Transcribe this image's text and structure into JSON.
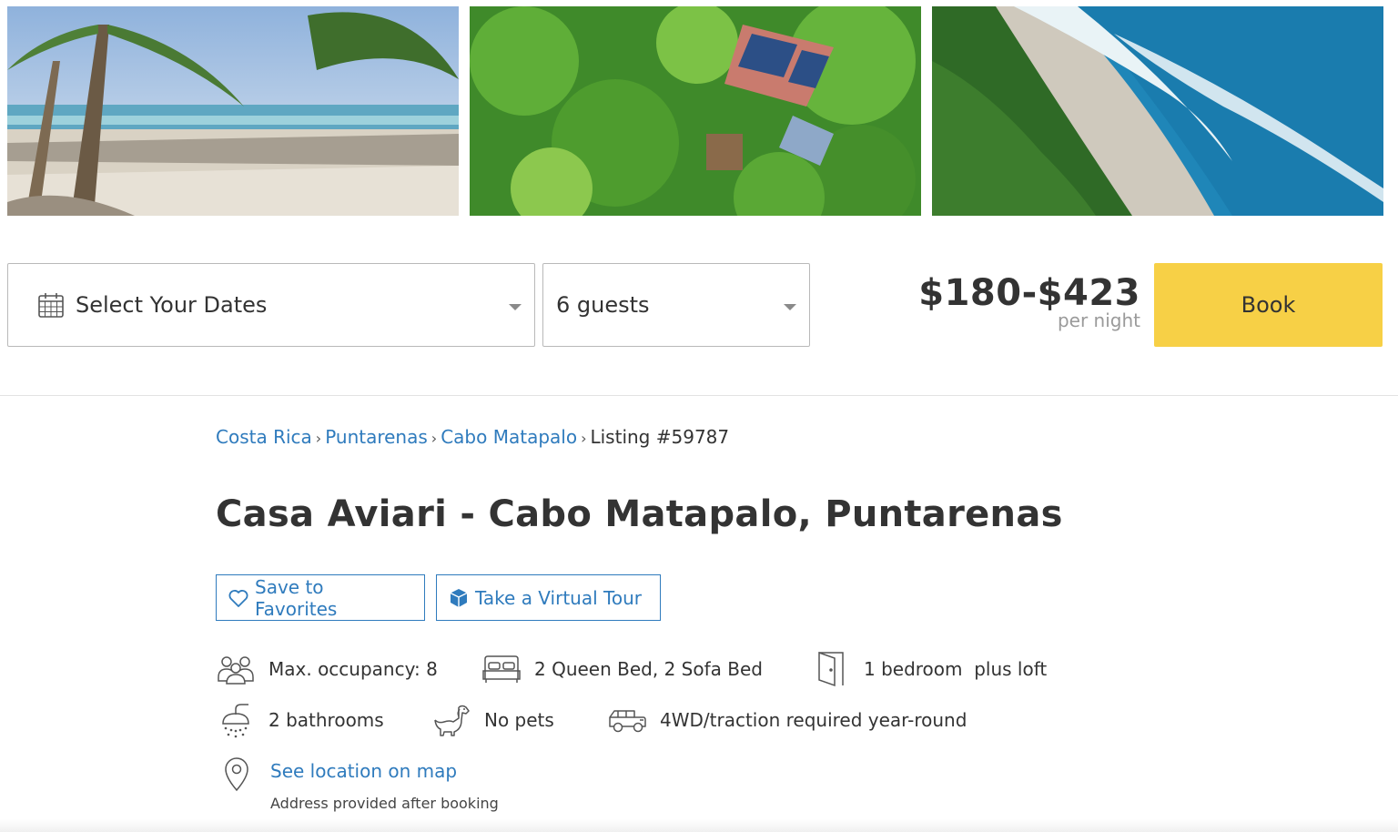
{
  "booking": {
    "dates_placeholder": "Select Your Dates",
    "guests_value": "6 guests",
    "price": "$180-$423",
    "price_unit": "per night",
    "book_label": "Book"
  },
  "breadcrumb": {
    "items": [
      "Costa Rica",
      "Puntarenas",
      "Cabo Matapalo"
    ],
    "current": "Listing #59787",
    "separator": "›"
  },
  "listing": {
    "title": "Casa Aviari - Cabo Matapalo, Puntarenas",
    "save_label": "Save to Favorites",
    "tour_label": "Take a Virtual Tour"
  },
  "features": {
    "occupancy": "Max. occupancy: 8",
    "beds": "2 Queen Bed, 2 Sofa Bed",
    "bedrooms": "1 bedroom  plus loft",
    "bathrooms": "2 bathrooms",
    "pets": "No pets",
    "vehicle": "4WD/traction required year-round"
  },
  "location": {
    "link_label": "See location on map",
    "note": "Address provided after booking"
  },
  "icons": {
    "dates": "calendar-icon",
    "save": "heart-icon",
    "tour": "cube-icon",
    "occupancy": "people-icon",
    "beds": "bed-icon",
    "bedrooms": "door-icon",
    "bathrooms": "shower-icon",
    "pets": "dog-icon",
    "vehicle": "jeep-icon",
    "location": "map-pin-icon"
  },
  "colors": {
    "link": "#2f7bbd",
    "book_button": "#f7d046",
    "text": "#333333"
  }
}
